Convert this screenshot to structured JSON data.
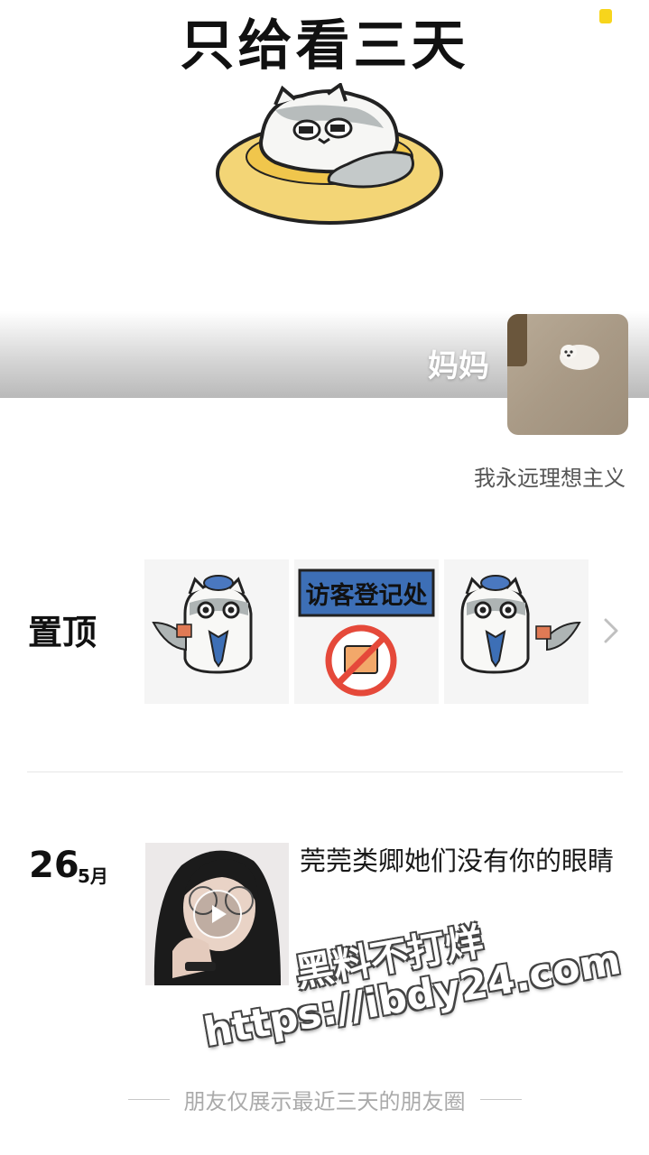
{
  "cover": {
    "title": "只给看三天"
  },
  "profile": {
    "name": "妈妈",
    "signature": "我永远理想主义"
  },
  "pinned": {
    "label": "置顶",
    "sign_text": "访客登记处"
  },
  "post": {
    "day": "26",
    "month": "5月",
    "text": "莞莞类卿她们没有你的眼睛"
  },
  "watermark": {
    "line1": "黑料不打烊",
    "line2": "https://ibdy24.com"
  },
  "footer": {
    "text": "朋友仅展示最近三天的朋友圈"
  },
  "colors": {
    "accent_yellow": "#f7d51c",
    "sign_blue": "#3d6fb6",
    "no_sign_red": "#e5493a"
  }
}
